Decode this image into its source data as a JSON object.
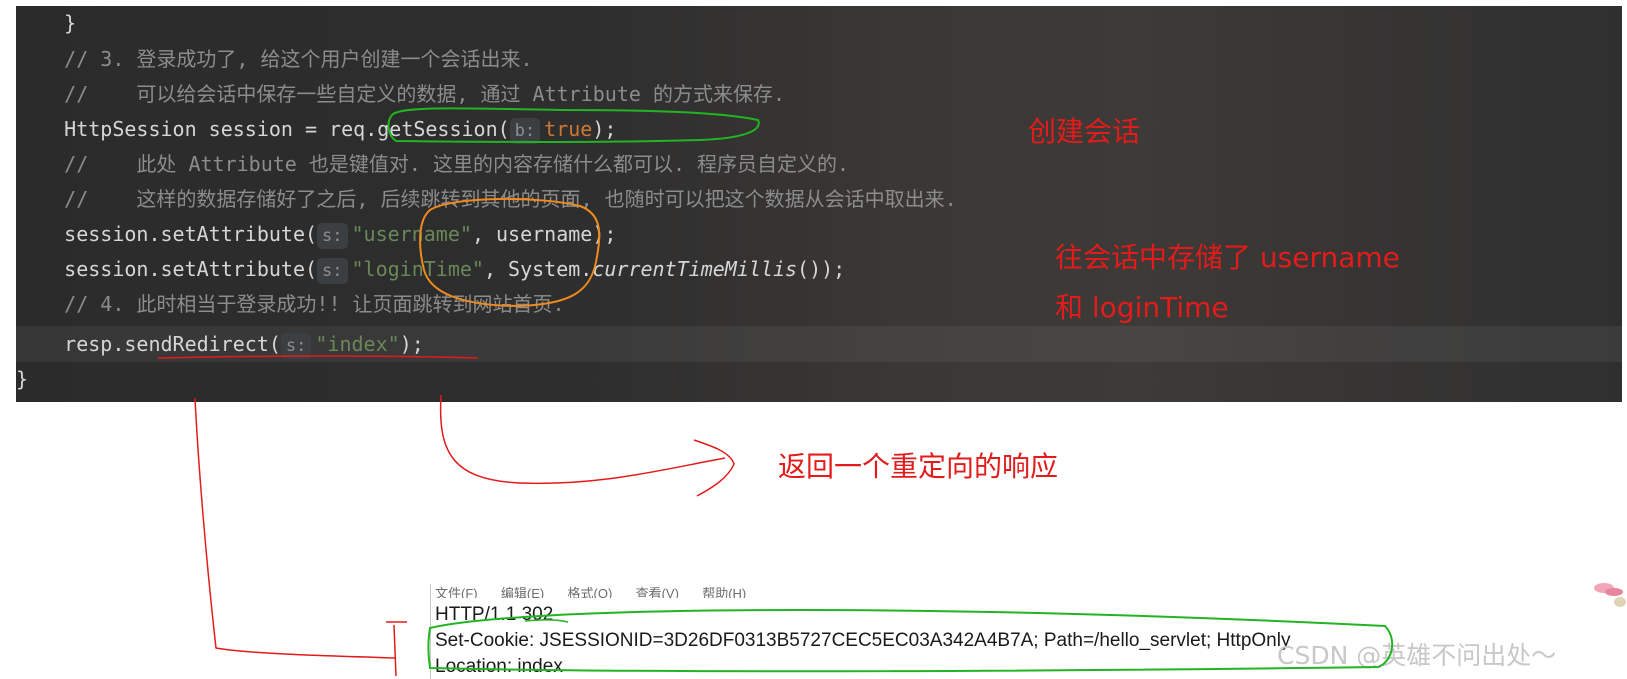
{
  "code": {
    "lines": [
      "    }",
      "    // 3. 登录成功了, 给这个用户创建一个会话出来.",
      "    //    可以给会话中保存一些自定义的数据, 通过 Attribute 的方式来保存.",
      "    HttpSession session = req.getSession(",
      "    //    此处 Attribute 也是键值对. 这里的内容存储什么都可以. 程序员自定义的.",
      "    //    这样的数据存储好了之后, 后续跳转到其他的页面, 也随时可以把这个数据从会话中取出来.",
      "    session.setAttribute(",
      "    session.setAttribute(",
      "    // 4. 此时相当于登录成功!! 让页面跳转到网站首页.",
      "    resp.sendRedirect(",
      "}"
    ],
    "hint_b": "b:",
    "hint_s": "s:",
    "kw_true": "true",
    "end_getsession": ");",
    "str_username": "\"username\"",
    "rest_username": ", username);",
    "str_logintime": "\"loginTime\"",
    "rest_logintime_1": ", System.",
    "method_currenttime": "currentTimeMillis",
    "rest_logintime_2": "());",
    "str_index": "\"index\"",
    "rest_index": ");"
  },
  "annotations": {
    "create_session": "创建会话",
    "store_line1": "往会话中存储了 username",
    "store_line2": "和 loginTime",
    "redirect": "返回一个重定向的响应"
  },
  "http": {
    "menu": [
      "文件(F)",
      "编辑(E)",
      "格式(O)",
      "查看(V)",
      "帮助(H)"
    ],
    "status_line": "HTTP/1.1 302",
    "set_cookie": "Set-Cookie: JSESSIONID=3D26DF0313B5727CEC5EC03A342A4B7A; Path=/hello_servlet; HttpOnly",
    "location": "Location: index"
  },
  "watermark": "CSDN @英雄不问出处～",
  "colors": {
    "annotation_red": "#e31b1b",
    "highlight_green": "#22b422",
    "highlight_orange": "#f08a1c",
    "comment_gray": "#8c8c8c",
    "keyword_orange": "#cc7832",
    "string_green": "#6a8759"
  }
}
